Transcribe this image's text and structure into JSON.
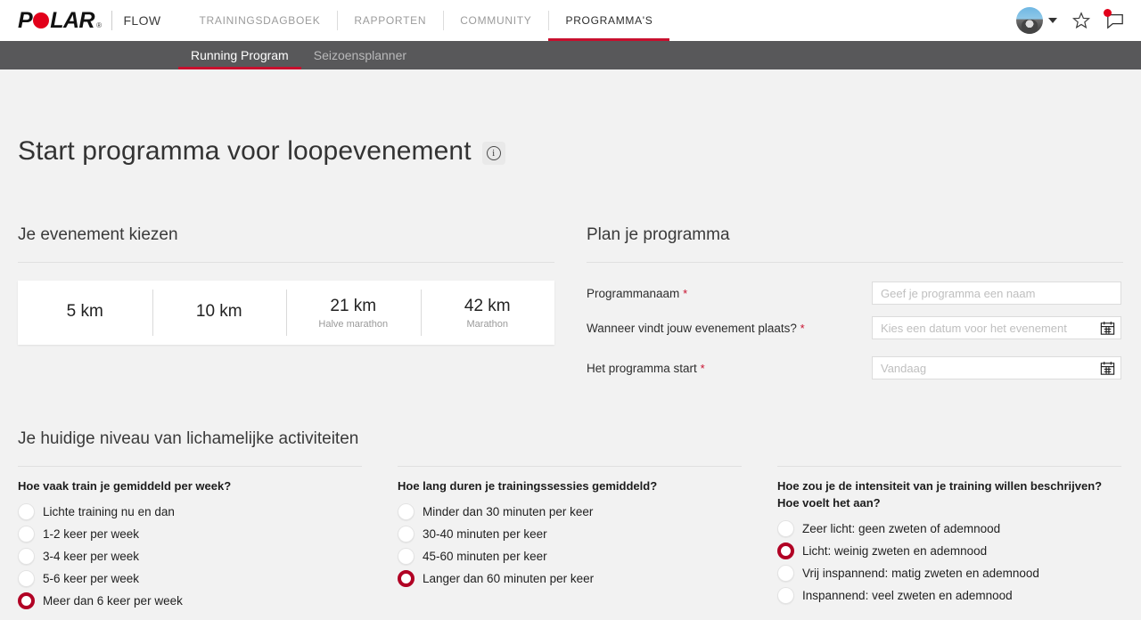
{
  "brand": {
    "logo_text_before": "P",
    "logo_text_after": "LAR",
    "registered": "®",
    "product": "FLOW"
  },
  "topnav": {
    "items": [
      {
        "label": "TRAININGSDAGBOEK",
        "active": false
      },
      {
        "label": "RAPPORTEN",
        "active": false
      },
      {
        "label": "COMMUNITY",
        "active": false
      },
      {
        "label": "PROGRAMMA'S",
        "active": true
      }
    ],
    "icons": {
      "avatar": "avatar",
      "caret": "chevron-down-icon",
      "favorite": "star-icon",
      "messages": "speech-bubble-icon"
    }
  },
  "subnav": {
    "items": [
      {
        "label": "Running Program",
        "active": true
      },
      {
        "label": "Seizoensplanner",
        "active": false
      }
    ]
  },
  "page": {
    "title": "Start programma voor loopevenement",
    "info_glyph": "i"
  },
  "event_section": {
    "heading": "Je evenement kiezen",
    "options": [
      {
        "distance": "5 km",
        "subtitle": ""
      },
      {
        "distance": "10 km",
        "subtitle": ""
      },
      {
        "distance": "21 km",
        "subtitle": "Halve marathon"
      },
      {
        "distance": "42 km",
        "subtitle": "Marathon"
      }
    ]
  },
  "plan_section": {
    "heading": "Plan je programma",
    "required_marker": "*",
    "fields": [
      {
        "label": "Programmanaam",
        "required": true,
        "value": "",
        "placeholder": "Geef je programma een naam",
        "has_calendar": false
      },
      {
        "label": "Wanneer vindt jouw evenement plaats?",
        "required": true,
        "value": "",
        "placeholder": "Kies een datum voor het evenement",
        "has_calendar": true
      },
      {
        "label": "Het programma start",
        "required": true,
        "value": "",
        "placeholder": "Vandaag",
        "has_calendar": true
      }
    ]
  },
  "activity_section": {
    "heading": "Je huidige niveau van lichamelijke activiteiten",
    "questions": [
      {
        "title": "Hoe vaak train je gemiddeld per week?",
        "options": [
          {
            "label": "Lichte training nu en dan",
            "checked": false
          },
          {
            "label": "1-2 keer per week",
            "checked": false
          },
          {
            "label": "3-4 keer per week",
            "checked": false
          },
          {
            "label": "5-6 keer per week",
            "checked": false
          },
          {
            "label": "Meer dan 6 keer per week",
            "checked": true
          }
        ]
      },
      {
        "title": "Hoe lang duren je trainingssessies gemiddeld?",
        "options": [
          {
            "label": "Minder dan 30 minuten per keer",
            "checked": false
          },
          {
            "label": "30-40 minuten per keer",
            "checked": false
          },
          {
            "label": "45-60 minuten per keer",
            "checked": false
          },
          {
            "label": "Langer dan 60 minuten per keer",
            "checked": true
          }
        ]
      },
      {
        "title": "Hoe zou je de intensiteit van je training willen beschrijven? Hoe voelt het aan?",
        "options": [
          {
            "label": "Zeer licht: geen zweten of ademnood",
            "checked": false
          },
          {
            "label": "Licht: weinig zweten en ademnood",
            "checked": true
          },
          {
            "label": "Vrij inspannend: matig zweten en ademnood",
            "checked": false
          },
          {
            "label": "Inspannend: veel zweten en ademnood",
            "checked": false
          }
        ]
      }
    ]
  },
  "colors": {
    "brand_red": "#e2001a",
    "accent_red": "#c8102e",
    "selected_radio": "#b10024",
    "subnav_bg": "#58585a",
    "page_bg": "#f2f2f2"
  }
}
